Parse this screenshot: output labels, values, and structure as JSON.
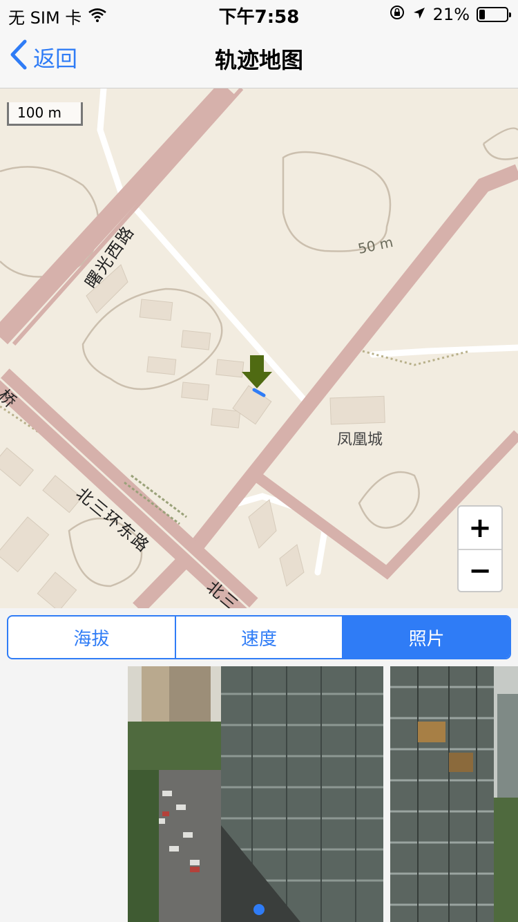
{
  "status": {
    "carrier": "无 SIM 卡",
    "time": "下午7:58",
    "battery": "21%",
    "battery_level": 0.21
  },
  "nav": {
    "back_label": "返回",
    "title": "轨迹地图"
  },
  "map": {
    "scale": "100 m",
    "labels": {
      "road_shuguang": "曙光西路",
      "road_bei3": "北三环东路",
      "road_bei3_partial": "北三",
      "bridge": "桥",
      "place": "凤凰城",
      "contour": "50 m"
    },
    "zoom_in": "+",
    "zoom_out": "−",
    "colors": {
      "land": "#f2ece0",
      "road": "#d6b1ab",
      "marker": "#4f6a12",
      "track": "#2f7cf6"
    }
  },
  "tabs": [
    {
      "label": "海拔",
      "active": false
    },
    {
      "label": "速度",
      "active": false
    },
    {
      "label": "照片",
      "active": true
    }
  ],
  "photos": {
    "count": 2,
    "current_page": 1,
    "accent": "#2f7cf6"
  }
}
